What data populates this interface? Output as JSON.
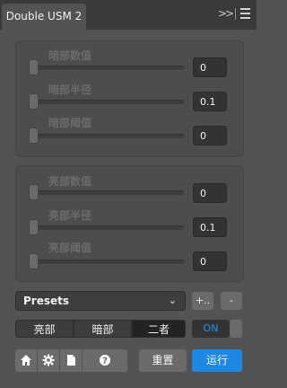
{
  "window": {
    "tab_title": "Double USM 2"
  },
  "shadows_group": {
    "sliders": [
      {
        "label": "暗部数值",
        "value": "0",
        "level": 0
      },
      {
        "label": "暗部半径",
        "value": "0.1",
        "level": 0
      },
      {
        "label": "暗部阈值",
        "value": "0",
        "level": 0
      }
    ]
  },
  "highlights_group": {
    "sliders": [
      {
        "label": "亮部数值",
        "value": "0",
        "level": 0
      },
      {
        "label": "亮部半径",
        "value": "0.1",
        "level": 0
      },
      {
        "label": "亮部阈值",
        "value": "0",
        "level": 0
      }
    ]
  },
  "presets": {
    "selected": "Presets",
    "add_label": "+..",
    "remove_label": "-"
  },
  "mode_tabs": [
    {
      "label": "亮部",
      "active": false
    },
    {
      "label": "暗部",
      "active": false
    },
    {
      "label": "二者",
      "active": true
    }
  ],
  "toggle": {
    "label": "ON",
    "color": "#2196f3"
  },
  "footer": {
    "icons": [
      "home-icon",
      "gear-icon",
      "document-icon",
      "help-icon"
    ],
    "reset_label": "重置",
    "run_label": "运行",
    "run_color": "#1e88e5"
  },
  "colors": {
    "panel_bg": "#535353",
    "group_bg": "#4d4d4d",
    "accent": "#2196f3"
  }
}
